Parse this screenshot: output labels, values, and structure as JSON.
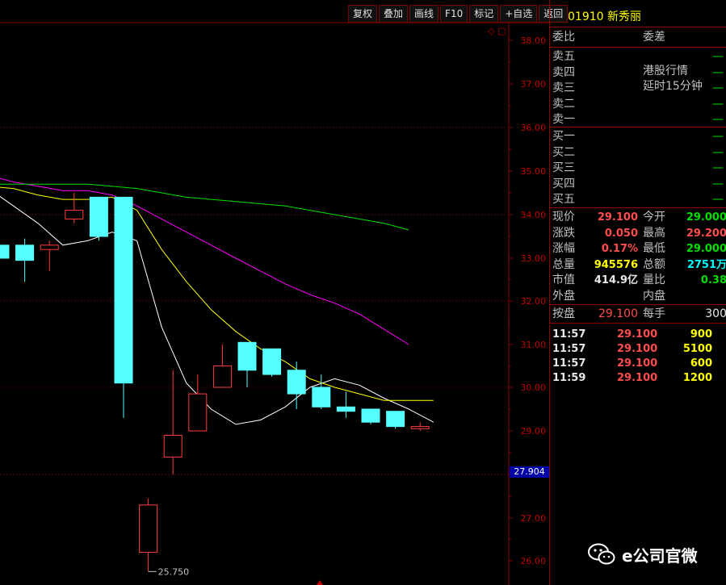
{
  "toolbar": {
    "buttons": [
      "复权",
      "叠加",
      "画线",
      "F10",
      "标记",
      "+自选",
      "返回"
    ]
  },
  "stock": {
    "code": "01910",
    "name": "新秀丽"
  },
  "panel": {
    "header": {
      "ratio_label": "委比",
      "diff_label": "委差"
    },
    "sell": [
      {
        "label": "卖五",
        "value": "—"
      },
      {
        "label": "卖四",
        "value": "—"
      },
      {
        "label": "卖三",
        "value": "—"
      },
      {
        "label": "卖二",
        "value": "—"
      },
      {
        "label": "卖一",
        "value": "—"
      }
    ],
    "notice_line1": "港股行情",
    "notice_line2": "延时15分钟",
    "buy": [
      {
        "label": "买一",
        "value": "—"
      },
      {
        "label": "买二",
        "value": "—"
      },
      {
        "label": "买三",
        "value": "—"
      },
      {
        "label": "买四",
        "value": "—"
      },
      {
        "label": "买五",
        "value": "—"
      }
    ],
    "quote": [
      {
        "l1": "现价",
        "v1": "29.100",
        "c1": "red",
        "l2": "今开",
        "v2": "29.000",
        "c2": "green"
      },
      {
        "l1": "涨跌",
        "v1": "0.050",
        "c1": "red",
        "l2": "最高",
        "v2": "29.200",
        "c2": "red"
      },
      {
        "l1": "涨幅",
        "v1": "0.17%",
        "c1": "red",
        "l2": "最低",
        "v2": "29.000",
        "c2": "green"
      },
      {
        "l1": "总量",
        "v1": "945576",
        "c1": "yellow",
        "l2": "总额",
        "v2": "2751万",
        "c2": "cyan"
      },
      {
        "l1": "市值",
        "v1": "414.9亿",
        "c1": "white",
        "l2": "量比",
        "v2": "0.38",
        "c2": "green"
      },
      {
        "l1": "外盘",
        "v1": "",
        "c1": "white",
        "l2": "内盘",
        "v2": "",
        "c2": "white"
      }
    ],
    "lot": {
      "l1": "按盘",
      "v1": "29.100",
      "l2": "每手",
      "v2": "300"
    },
    "trades": [
      {
        "time": "11:57",
        "price": "29.100",
        "vol": "900"
      },
      {
        "time": "11:57",
        "price": "29.100",
        "vol": "5100"
      },
      {
        "time": "11:57",
        "price": "29.100",
        "vol": "600"
      },
      {
        "time": "11:59",
        "price": "29.100",
        "vol": "1200"
      }
    ]
  },
  "watermark": "e公司官微",
  "chart_data": {
    "type": "candlestick",
    "y_ticks": [
      "38.00",
      "37.00",
      "36.00",
      "35.00",
      "34.00",
      "33.00",
      "32.00",
      "31.00",
      "30.00",
      "29.00",
      "27.00",
      "26.00"
    ],
    "y_range": [
      25.7,
      38.3
    ],
    "current_price_label": "27.904",
    "low_label": "25.750",
    "candles": [
      {
        "o": 33.3,
        "c": 33.0,
        "h": 33.3,
        "l": 33.0
      },
      {
        "o": 33.3,
        "c": 32.95,
        "h": 33.45,
        "l": 32.45
      },
      {
        "o": 33.2,
        "c": 33.3,
        "h": 33.4,
        "l": 32.7
      },
      {
        "o": 33.9,
        "c": 34.1,
        "h": 34.5,
        "l": 33.8
      },
      {
        "o": 34.4,
        "c": 33.5,
        "h": 34.4,
        "l": 33.4
      },
      {
        "o": 34.4,
        "c": 30.1,
        "h": 34.4,
        "l": 29.3
      },
      {
        "o": 26.2,
        "c": 27.3,
        "h": 27.45,
        "l": 25.75
      },
      {
        "o": 28.4,
        "c": 28.9,
        "h": 30.4,
        "l": 28.0
      },
      {
        "o": 29.0,
        "c": 29.85,
        "h": 30.3,
        "l": 29.0
      },
      {
        "o": 30.0,
        "c": 30.5,
        "h": 31.0,
        "l": 30.0
      },
      {
        "o": 31.05,
        "c": 30.4,
        "h": 31.05,
        "l": 30.0
      },
      {
        "o": 30.9,
        "c": 30.3,
        "h": 30.9,
        "l": 30.25
      },
      {
        "o": 30.4,
        "c": 29.85,
        "h": 30.6,
        "l": 29.5
      },
      {
        "o": 30.0,
        "c": 29.55,
        "h": 30.3,
        "l": 29.5
      },
      {
        "o": 29.55,
        "c": 29.45,
        "h": 29.9,
        "l": 29.3
      },
      {
        "o": 29.5,
        "c": 29.2,
        "h": 29.5,
        "l": 29.15
      },
      {
        "o": 29.45,
        "c": 29.1,
        "h": 29.45,
        "l": 29.05
      },
      {
        "o": 29.05,
        "c": 29.1,
        "h": 29.2,
        "l": 29.0
      }
    ],
    "ma_lines": [
      {
        "color": "#ffffff",
        "values": [
          34.6,
          34.2,
          33.8,
          33.3,
          33.4,
          33.6,
          33.4,
          31.4,
          30.1,
          29.5,
          29.15,
          29.25,
          29.55,
          30.0,
          30.2,
          30.05,
          29.75,
          29.5,
          29.2
        ]
      },
      {
        "color": "#ffff00",
        "values": [
          34.65,
          34.6,
          34.45,
          34.35,
          34.35,
          34.4,
          34.1,
          33.2,
          32.45,
          31.8,
          31.3,
          30.9,
          30.6,
          30.2,
          30.0,
          29.85,
          29.7,
          29.7,
          29.7
        ]
      },
      {
        "color": "#ff00ff",
        "values": [
          34.9,
          34.75,
          34.65,
          34.55,
          34.55,
          34.45,
          34.2,
          33.9,
          33.6,
          33.3,
          33.0,
          32.7,
          32.4,
          32.15,
          31.95,
          31.7,
          31.35,
          31.0
        ]
      },
      {
        "color": "#00e000",
        "values": [
          34.7,
          34.7,
          34.7,
          34.7,
          34.7,
          34.65,
          34.6,
          34.5,
          34.4,
          34.35,
          34.3,
          34.25,
          34.2,
          34.1,
          34.0,
          33.9,
          33.8,
          33.65
        ]
      }
    ]
  }
}
